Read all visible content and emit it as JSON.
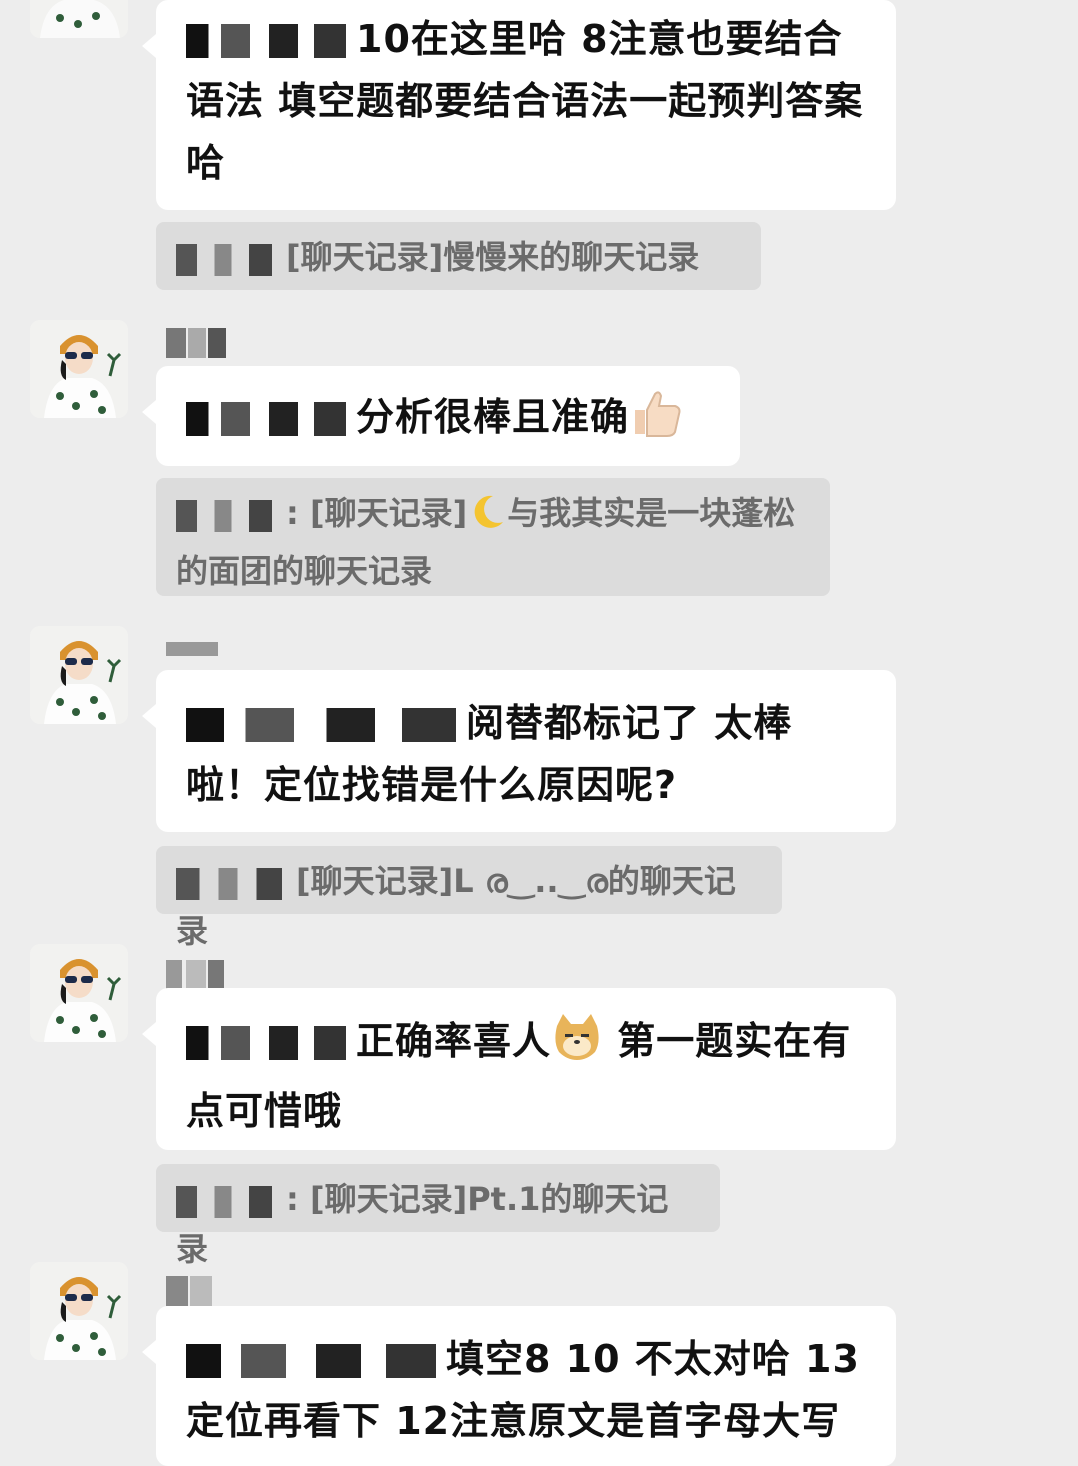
{
  "messages": [
    {
      "text": "10在这里哈 8注意也要结合语法 填空题都要结合语法一起预判答案哈",
      "quote": "[聊天记录]慢慢来的聊天记录"
    },
    {
      "text": "分析很棒且准确",
      "emoji": "thumbs-up",
      "quote_pre": "[聊天记录]",
      "quote_emoji": "crescent-moon",
      "quote_post": "与我其实是一块蓬松的面团的聊天记录",
      "quote_sep": ": "
    },
    {
      "text": "阅替都标记了 太棒啦！定位找错是什么原因呢?",
      "quote": "[聊天记录]L ര‿..‿ര的聊天记录"
    },
    {
      "text_pre": "正确率喜人",
      "emoji": "doge-face",
      "text_post": " 第一题实在有点可惜哦",
      "quote": "[聊天记录]Pt.1的聊天记录",
      "quote_sep": ": "
    },
    {
      "text": "填空8 10 不太对哈 13定位再看下 12注意原文是首字母大写"
    }
  ]
}
